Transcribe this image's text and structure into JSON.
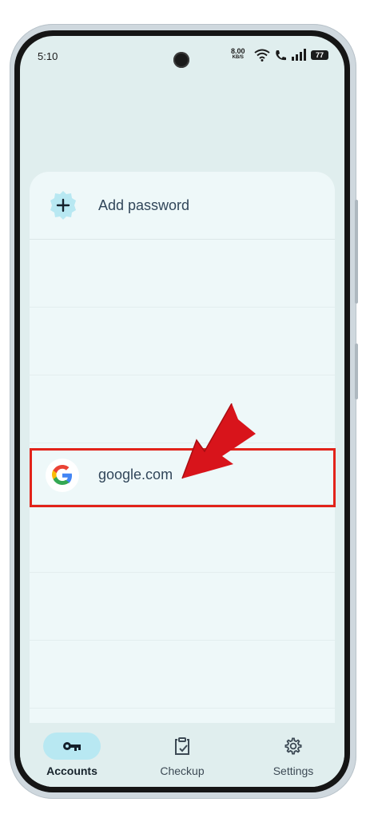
{
  "status_bar": {
    "time": "5:10",
    "net_speed": "8.00",
    "net_unit": "KB/S",
    "battery": "77"
  },
  "list": {
    "add_label": "Add password",
    "items": [
      {
        "label": "google.com",
        "icon": "google-logo-icon"
      }
    ]
  },
  "nav": {
    "items": [
      {
        "label": "Accounts",
        "icon": "key-icon",
        "active": true
      },
      {
        "label": "Checkup",
        "icon": "clipboard-check-icon",
        "active": false
      },
      {
        "label": "Settings",
        "icon": "gear-icon",
        "active": false
      }
    ]
  },
  "colors": {
    "screen_bg": "#e0eeee",
    "card_bg": "#eef8f9",
    "active_pill": "#b8e8f2",
    "highlight": "#e2231a"
  }
}
